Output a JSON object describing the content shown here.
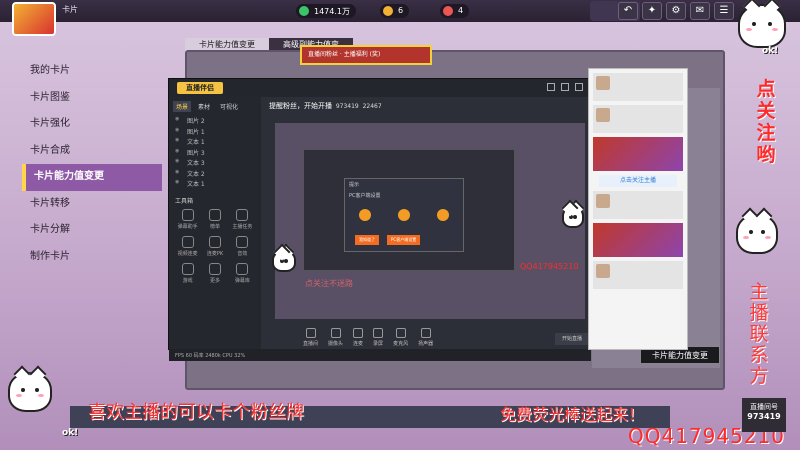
{
  "game": {
    "title": "卡片",
    "currency": [
      {
        "label": "1474.1万",
        "color": "#3cc46b"
      },
      {
        "label": "6",
        "color": "#f2b233"
      },
      {
        "label": "4",
        "color": "#e55"
      }
    ],
    "top_icons": [
      "back-icon",
      "gift-icon",
      "gear-icon",
      "mail-icon",
      "chat-icon"
    ]
  },
  "sidebar": {
    "items": [
      {
        "label": "我的卡片"
      },
      {
        "label": "卡片图鉴"
      },
      {
        "label": "卡片强化"
      },
      {
        "label": "卡片合成"
      },
      {
        "label": "卡片能力值变更"
      },
      {
        "label": "卡片转移"
      },
      {
        "label": "卡片分解"
      },
      {
        "label": "制作卡片"
      }
    ]
  },
  "panel": {
    "tabs": [
      "卡片能力值变更",
      "高级副能力值变"
    ],
    "cta_label": "卡片能力值变更"
  },
  "obs": {
    "logo": "直播伴侣",
    "left_tabs": [
      "场景",
      "素材",
      "可视化"
    ],
    "scenes": [
      "图片 2",
      "图片 1",
      "文本 1",
      "图片 3",
      "文本 3",
      "文本 2",
      "文本 1"
    ],
    "tools_title": "工具箱",
    "tools": [
      "弹幕助手",
      "榜单",
      "主播任务",
      "视频连麦",
      "连麦PK",
      "音效",
      "游戏",
      "更多",
      "弹幕库"
    ],
    "info_line1": "提醒粉丝，开始开播",
    "info_line2": "973419",
    "info_line3": "22467",
    "dialog_title": "提示",
    "dialog_text": "PC客户端设置",
    "dialog_btn1": "我知道了",
    "dialog_btn2": "PC客户端设置",
    "bottom_buttons": [
      "直播间",
      "摄像头",
      "连麦",
      "录屏",
      "麦克风",
      "扬声器"
    ],
    "start_label": "开始直播",
    "status": "FPS 60  码率 2480k  CPU 32%"
  },
  "chat": {
    "button": "点击关注主播"
  },
  "overlays": {
    "banner": "直播间粉丝 · 主播福利 (奖)",
    "vertical_top": [
      "点",
      "关",
      "注",
      "哟"
    ],
    "vertical_bottom": [
      "主",
      "播",
      "联",
      "系",
      "方"
    ],
    "bottom_left": "喜欢主播的可以卡个粉丝牌",
    "bottom_right": "免费荧光棒送起来！",
    "qq_big": "QQ417945210",
    "qq_small": "QQ417945210",
    "faint": "点关注不迷路",
    "counter_label": "直播间号",
    "counter_value": "973419",
    "ok": "ok!"
  }
}
